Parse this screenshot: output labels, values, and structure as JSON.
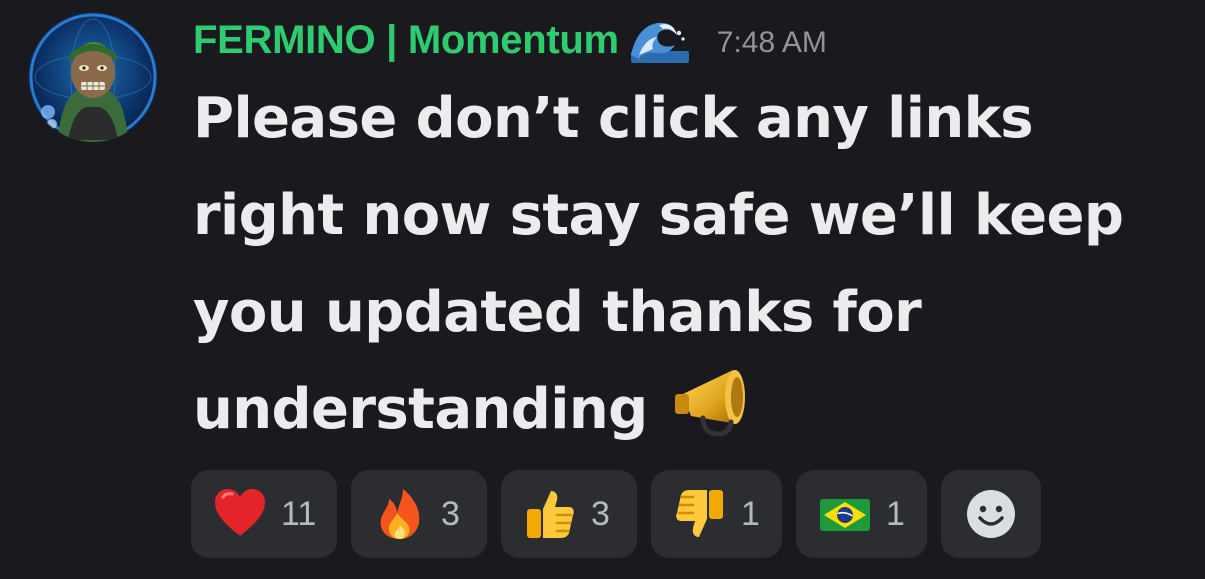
{
  "message": {
    "author": "FERMINO | Momentum",
    "author_color": "#2ecc71",
    "badge_icon": "ocean-wave-icon",
    "timestamp": "7:48 AM",
    "text": "Please don’t click any links right now stay safe we’ll keep you updated thanks for understanding",
    "trailing_emoji": "megaphone-icon"
  },
  "reactions": [
    {
      "emoji": "red-heart-icon",
      "count": "11"
    },
    {
      "emoji": "fire-icon",
      "count": "3"
    },
    {
      "emoji": "thumbs-up-icon",
      "count": "3"
    },
    {
      "emoji": "thumbs-down-icon",
      "count": "1"
    },
    {
      "emoji": "brazil-flag-icon",
      "count": "1"
    }
  ],
  "add_reaction_icon": "add-reaction-smiley-icon",
  "colors": {
    "background": "#1a1a1e",
    "reaction_bg": "#2b2d31",
    "timestamp": "#8f939b",
    "text": "#ececee"
  }
}
